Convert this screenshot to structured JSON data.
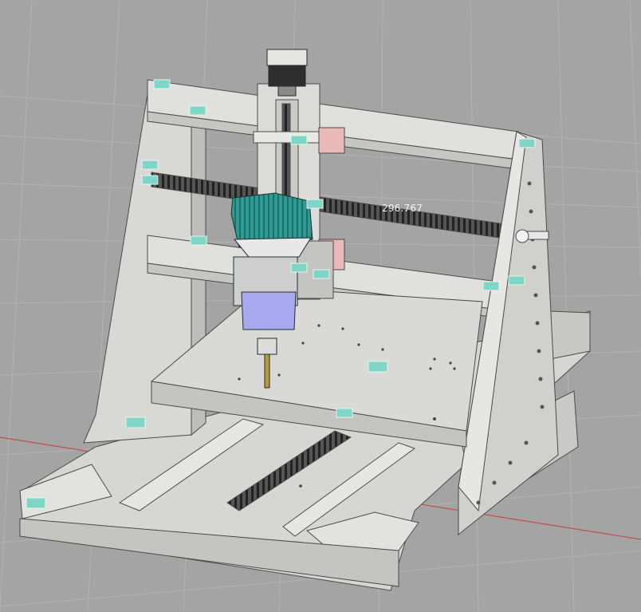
{
  "viewport": {
    "dimension_label": "296.767",
    "colors": {
      "background": "#a4a4a4",
      "grid": "#b3b3b3",
      "x_axis": "#c05050",
      "frame": "#dcdcd8",
      "frame_shadow": "#b8b8b4",
      "edge": "#4a4a4a",
      "router_body": "#2e9a94",
      "router_collet": "#a8a8f0",
      "carriage_block": "#eab8b8",
      "constraint_marker": "#7ed6c6"
    },
    "icons": [
      "constraint-marker-icon",
      "coordinate-grid",
      "dimension-annotation"
    ]
  }
}
